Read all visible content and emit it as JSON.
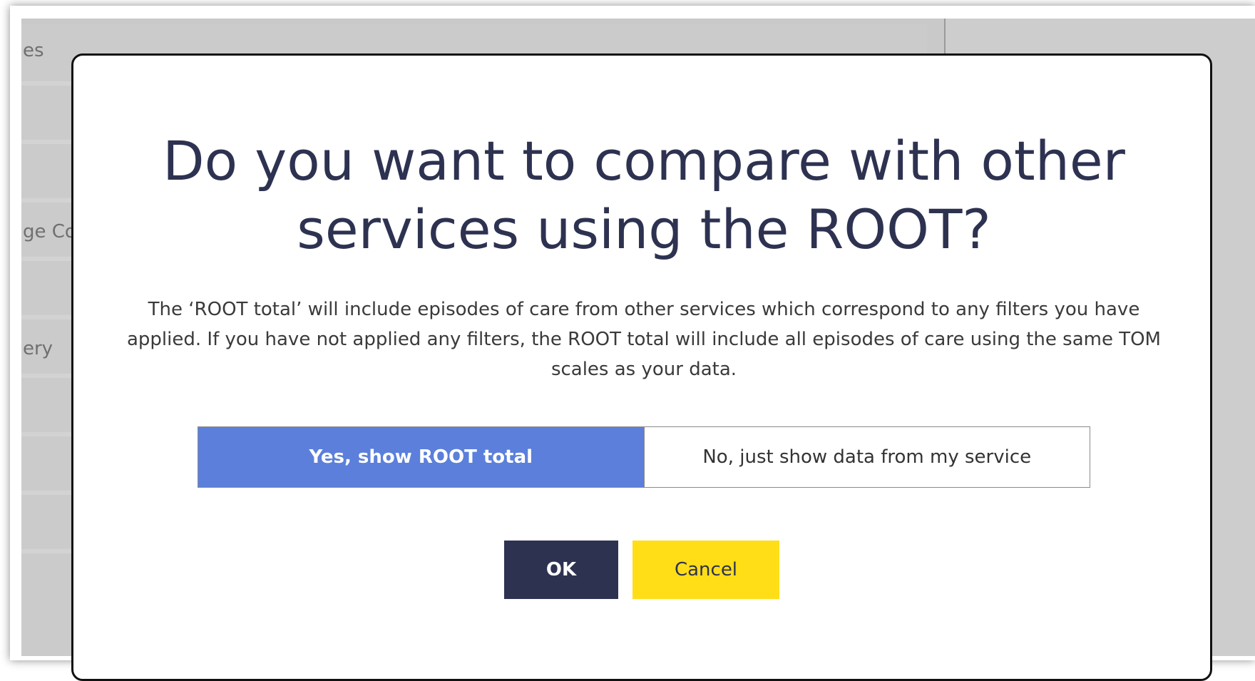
{
  "background": {
    "row_labels": [
      "es",
      "ge Co",
      "ery"
    ]
  },
  "modal": {
    "title": "Do you want to compare with other services using the ROOT?",
    "description": "The ‘ROOT total’ will include episodes of care from other services which correspond to any filters you have applied. If you have not applied any filters, the ROOT total will include all episodes of care using the same TOM scales as your data.",
    "toggle": {
      "options": [
        {
          "label": "Yes, show ROOT total",
          "selected": true
        },
        {
          "label": "No, just show data from my service",
          "selected": false
        }
      ]
    },
    "ok_label": "OK",
    "cancel_label": "Cancel"
  },
  "colors": {
    "title": "#2e3251",
    "selected_option": "#5b7fdb",
    "ok_button": "#2e3251",
    "cancel_button": "#ffde17"
  }
}
